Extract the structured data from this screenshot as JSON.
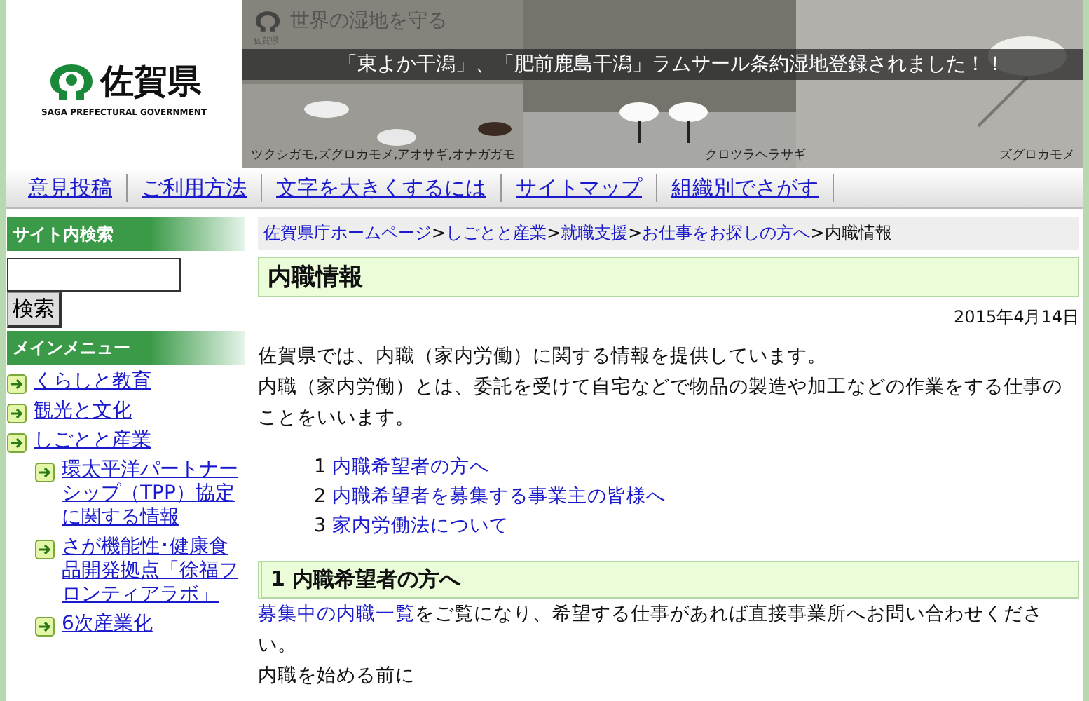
{
  "header": {
    "logo": {
      "name": "佐賀県",
      "subtitle": "SAGA PREFECTURAL GOVERNMENT"
    },
    "banner": {
      "kind": "picture",
      "tagline": "世界の湿地を守る",
      "tag_mark": "佐賀県",
      "headline": "「東よか干潟」、「肥前鹿島干潟」ラムサール条約湿地登録されました！！",
      "captions": [
        "ツクシガモ,ズグロカモメ,アオサギ,オナガガモ",
        "クロツラヘラサギ",
        "ズグロカモメ"
      ]
    }
  },
  "nav": [
    "意見投稿",
    "ご利用方法",
    "文字を大きくするには",
    "サイトマップ",
    "組織別でさがす"
  ],
  "sidebar": {
    "search_title": "サイト内検索",
    "search_button": "検索",
    "menu_title": "メインメニュー",
    "items": [
      {
        "label": "くらしと教育"
      },
      {
        "label": "観光と文化"
      },
      {
        "label": "しごとと産業",
        "children": [
          {
            "label": "環太平洋パートナーシップ（TPP）協定に関する情報"
          },
          {
            "label": "さが機能性･健康食品開発拠点「徐福フロンティアラボ」"
          },
          {
            "label": "6次産業化"
          }
        ]
      }
    ]
  },
  "breadcrumb": {
    "links": [
      "佐賀県庁ホームページ",
      "しごとと産業",
      "就職支援",
      "お仕事をお探しの方へ"
    ],
    "separator": ">",
    "current": "内職情報"
  },
  "title": "内職情報",
  "date": "2015年4月14日",
  "intro": [
    "佐賀県では、内職（家内労働）に関する情報を提供しています。",
    "内職（家内労働）とは、委託を受けて自宅などで物品の製造や加工などの作業をする仕事のことをいいます。"
  ],
  "toc": [
    {
      "number": "1",
      "label": "内職希望者の方へ"
    },
    {
      "number": "2",
      "label": "内職希望者を募集する事業主の皆様へ"
    },
    {
      "number": "3",
      "label": "家内労働法について"
    }
  ],
  "section": {
    "title": "1 内職希望者の方へ",
    "link": "募集中の内職一覧",
    "text": "をご覧になり、希望する仕事があれば直接事業所へお問い合わせください。",
    "next": "内職を始める前に"
  }
}
